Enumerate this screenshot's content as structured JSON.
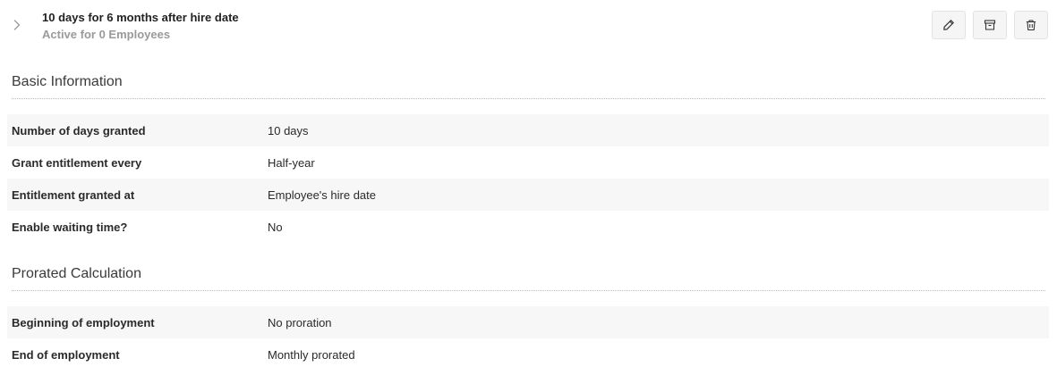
{
  "header": {
    "title": "10 days for 6 months after hire date",
    "subtitle": "Active for 0 Employees"
  },
  "actions": {
    "icons": [
      "pencil-icon",
      "archive-icon",
      "trash-icon"
    ]
  },
  "basic_information": {
    "title": "Basic Information",
    "rows": [
      {
        "label": "Number of days granted",
        "value": "10 days"
      },
      {
        "label": "Grant entitlement every",
        "value": "Half-year"
      },
      {
        "label": "Entitlement granted at",
        "value": "Employee's hire date"
      },
      {
        "label": "Enable waiting time?",
        "value": "No"
      }
    ]
  },
  "prorated_calculation": {
    "title": "Prorated Calculation",
    "rows": [
      {
        "label": "Beginning of employment",
        "value": "No proration"
      },
      {
        "label": "End of employment",
        "value": "Monthly prorated"
      }
    ]
  },
  "colors": {
    "row_stripe": "#f7f7f7",
    "button_bg": "#f5f5f5",
    "muted_text": "#9a9a9a"
  }
}
